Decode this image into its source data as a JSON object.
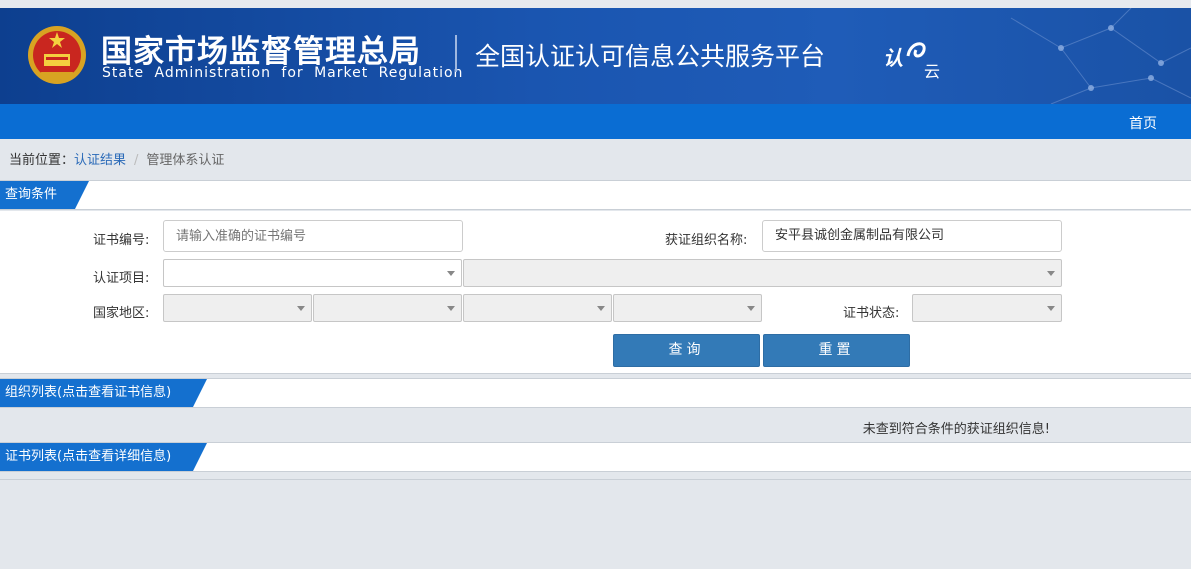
{
  "header": {
    "org_name_cn": "国家市场监督管理总局",
    "org_name_en": "State Administration for Market Regulation",
    "platform_name": "全国认证认可信息公共服务平台",
    "logo_text_1": "认",
    "logo_text_2": "云"
  },
  "nav": {
    "home_label": "首页"
  },
  "breadcrumb": {
    "prefix": "当前位置：",
    "link": "认证结果",
    "current": "管理体系认证"
  },
  "query_panel": {
    "tab_label": "查询条件",
    "cert_no_label": "证书编号:",
    "cert_no_placeholder": "请输入准确的证书编号",
    "cert_no_value": "",
    "org_name_label": "获证组织名称:",
    "org_name_value": "安平县诚创金属制品有限公司",
    "project_label": "认证项目:",
    "region_label": "国家地区:",
    "status_label": "证书状态:",
    "search_button": "查询",
    "reset_button": "重置"
  },
  "org_list": {
    "tab_label": "组织列表(点击查看证书信息)",
    "empty_message": "未查到符合条件的获证组织信息!"
  },
  "cert_list": {
    "tab_label": "证书列表(点击查看详细信息)"
  },
  "colors": {
    "header_bg": "#1a55b0",
    "nav_bg": "#0a6dd3",
    "tab_bg": "#1470cf",
    "button_bg": "#337ab7"
  }
}
